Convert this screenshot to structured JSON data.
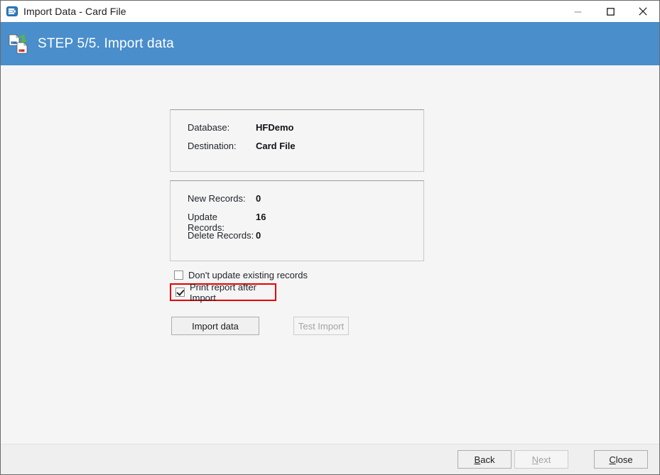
{
  "titlebar": {
    "title": "Import Data - Card File",
    "icon": "app-window-icon",
    "minimize_label": "—",
    "maximize_label": "□",
    "close_label": "✕"
  },
  "header": {
    "title": "STEP 5/5. Import data",
    "icon": "import-document-icon",
    "background_color": "#4a8ecb"
  },
  "panels": {
    "database_panel": [
      {
        "label": "Database:",
        "value": "HFDemo"
      },
      {
        "label": "Destination:",
        "value": "Card File"
      }
    ],
    "records_panel": [
      {
        "label": "New Records:",
        "value": "0"
      },
      {
        "label": "Update Records:",
        "value": "16"
      },
      {
        "label": "Delete Records:",
        "value": "0"
      }
    ]
  },
  "options": {
    "dont_update": {
      "label": "Don't update existing records",
      "checked": false
    },
    "print_report": {
      "label": "Print report after Import",
      "checked": true,
      "highlight_color": "#e40000"
    }
  },
  "actions": {
    "import": {
      "label": "Import data",
      "enabled": true
    },
    "test": {
      "label": "Test Import",
      "enabled": false
    }
  },
  "footer": {
    "back": {
      "accel": "B",
      "rest": "ack",
      "enabled": true
    },
    "next": {
      "accel": "N",
      "rest": "ext",
      "enabled": false
    },
    "close": {
      "accel": "C",
      "rest": "lose",
      "enabled": true
    }
  }
}
